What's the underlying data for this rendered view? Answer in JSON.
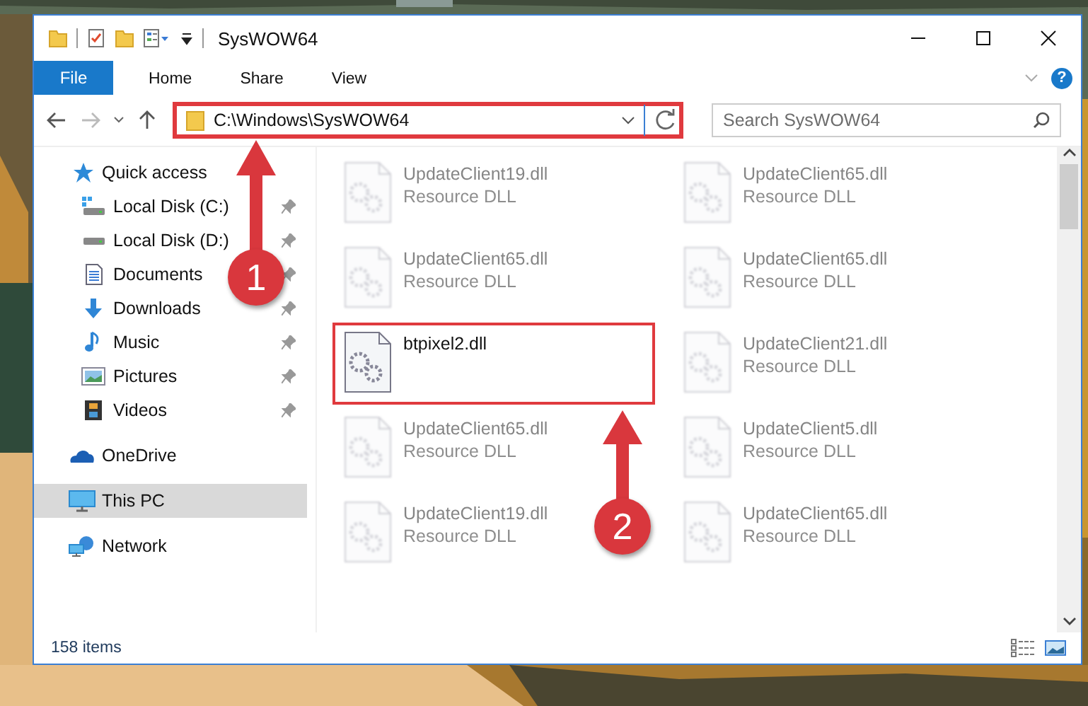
{
  "window": {
    "title": "SysWOW64",
    "help": "?"
  },
  "ribbon": {
    "file_button": "File",
    "tabs": [
      {
        "label": "Home",
        "selected": false
      },
      {
        "label": "Share",
        "selected": false
      },
      {
        "label": "View",
        "selected": false
      }
    ]
  },
  "address": {
    "path": "C:\\Windows\\SysWOW64",
    "highlighted": true,
    "search_placeholder": "Search SysWOW64"
  },
  "navigation": [
    {
      "label": "Quick access",
      "selected": false,
      "children": [
        {
          "label": "Local Disk (C:)",
          "pinned": true
        },
        {
          "label": "Local Disk (D:)",
          "pinned": true
        },
        {
          "label": "Documents",
          "pinned": true
        },
        {
          "label": "Downloads",
          "pinned": true
        },
        {
          "label": "Music",
          "pinned": true
        },
        {
          "label": "Pictures",
          "pinned": true
        },
        {
          "label": "Videos",
          "pinned": true
        }
      ]
    },
    {
      "label": "OneDrive",
      "selected": false
    },
    {
      "label": "This PC",
      "selected": true
    },
    {
      "label": "Network",
      "selected": false
    }
  ],
  "files": [
    {
      "name": "UpdateClient19.dll",
      "type": "Resource DLL",
      "highlighted": false
    },
    {
      "name": "UpdateClient65.dll",
      "type": "Resource DLL",
      "highlighted": false
    },
    {
      "name": "UpdateClient65.dll",
      "type": "Resource DLL",
      "highlighted": false
    },
    {
      "name": "UpdateClient65.dll",
      "type": "Resource DLL",
      "highlighted": false
    },
    {
      "name": "btpixel2.dll",
      "highlighted": true
    },
    {
      "name": "UpdateClient21.dll",
      "type": "Resource DLL",
      "highlighted": false
    },
    {
      "name": "UpdateClient65.dll",
      "type": "Resource DLL",
      "highlighted": false
    },
    {
      "name": "UpdateClient5.dll",
      "type": "Resource DLL",
      "highlighted": false
    },
    {
      "name": "UpdateClient19.dll",
      "type": "Resource DLL",
      "highlighted": false
    },
    {
      "name": "UpdateClient65.dll",
      "type": "Resource DLL",
      "highlighted": false
    }
  ],
  "status_bar": {
    "count": "158 items"
  },
  "callouts": [
    {
      "number": "1"
    },
    {
      "number": "2"
    }
  ]
}
